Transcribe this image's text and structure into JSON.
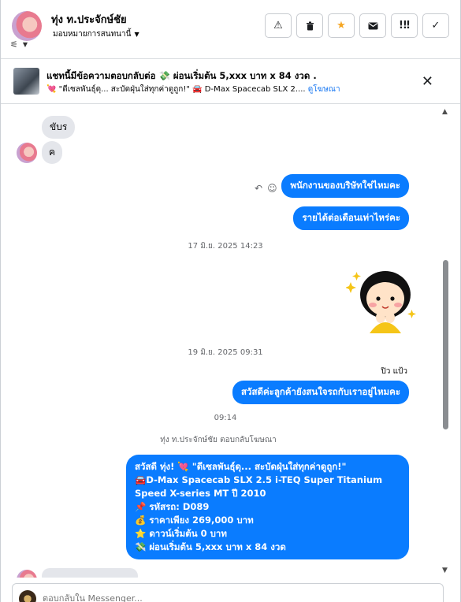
{
  "header": {
    "user_name": "ทุ่ง ท.ประจักษ์ชัย",
    "assign_label": "มอบหมายการสนทนานี้",
    "actions": [
      {
        "name": "spam-button",
        "icon": "warning-icon",
        "glyph": "⚠"
      },
      {
        "name": "delete-button",
        "icon": "trash-icon",
        "glyph": "🗑"
      },
      {
        "name": "star-button",
        "icon": "star-icon",
        "glyph": "★"
      },
      {
        "name": "mark-unread-button",
        "icon": "envelope-icon",
        "glyph": "✉"
      },
      {
        "name": "follow-up-button",
        "icon": "follow-up-icon",
        "glyph": "!⃝"
      },
      {
        "name": "done-button",
        "icon": "check-icon",
        "glyph": "✓"
      }
    ]
  },
  "banner": {
    "title": "แชทนี้มีข้อความตอบกลับต่อ 💸 ผ่อนเริ่มต้น 5,xxx บาท x 84 งวด .",
    "subtitle": "💘 \"ดีเซลพันธุ์ดุ... สะบัดฝุ่นใส่ทุกค่าดูถูก!\" 🚘 D-Max Spacecab SLX 2....",
    "link": "ดูโฆษณา"
  },
  "messages": {
    "in_1": "ขับร",
    "in_2": "ค",
    "out_1": "พนักงานของบริษัทใช่ไหมคะ",
    "out_2": "รายได้ต่อเดือนเท่าไหร่คะ",
    "ts_1": "17 มิ.ย. 2025 14:23",
    "ts_2": "19 มิ.ย. 2025 09:31",
    "seen": "ปิว แป้ว",
    "out_3": "สวัสดีค่ะลูกค้ายังสนใจรถกับเราอยู่ไหมคะ",
    "ts_3": "09:14",
    "replied_to_ad": "ทุ่ง ท.ประจักษ์ชัย ตอบกลับโฆษณา",
    "ad_reply_lines": [
      "สวัสดี ทุ่ง! 💘 \"ดีเซลพันธุ์ดุ... สะบัดฝุ่นใส่ทุกค่าดูถูก!\"",
      "🚘D-Max Spacecab SLX 2.5 i-TEQ Super Titanium Speed X-series MT ปี 2010",
      "📌 รหัสรถ: D089",
      "💰 ราคาเพียง 269,000 บาท",
      "⭐ ดาวน์เริ่มต้น 0 บาท",
      "💸 ผ่อนเริ่มต้น 5,xxx บาท x 84 งวด"
    ]
  },
  "composer": {
    "placeholder": "ตอบกลับใน Messenger..."
  },
  "colors": {
    "accent": "#0a7cff",
    "incoming": "#e4e6eb"
  }
}
